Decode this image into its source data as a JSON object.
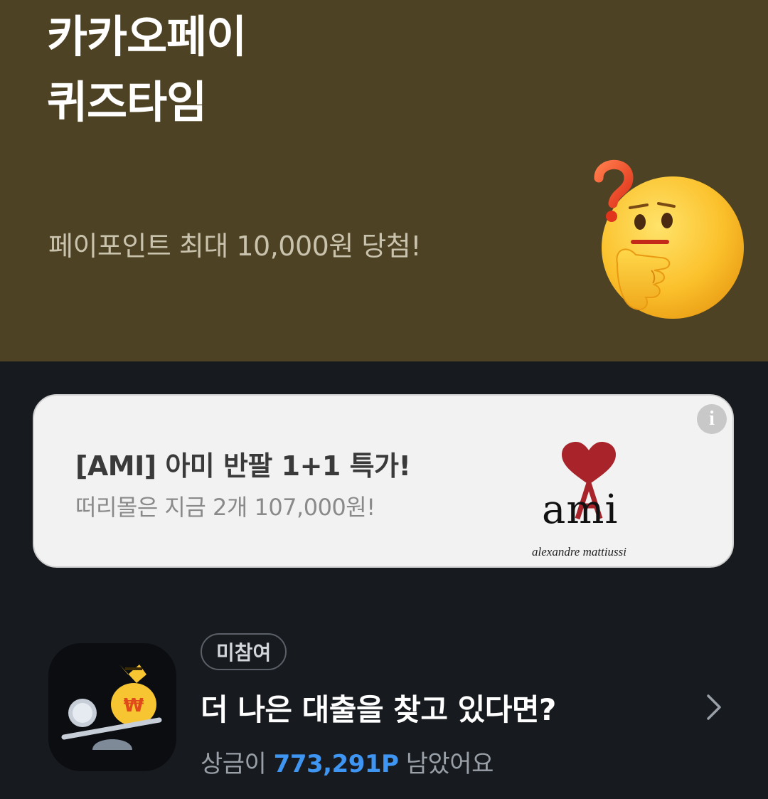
{
  "hero": {
    "title_line1": "카카오페이",
    "title_line2": "퀴즈타임",
    "subtitle": "페이포인트 최대 10,000원 당첨!",
    "bg_color": "#4e4224",
    "emoji_icon": "thinking-face-icon"
  },
  "ad": {
    "title": "[AMI] 아미 반팔 1+1 특가!",
    "description": "떠리몰은 지금 2개 107,000원!",
    "logo_word": "ami",
    "logo_sub": "alexandre mattiussi",
    "info_icon": "i",
    "brand_color": "#a8232a"
  },
  "quiz": {
    "badge": "미참여",
    "title": "더 나은 대출을 찾고 있다면?",
    "prize_prefix": "상금이",
    "prize_amount": "773,291P",
    "prize_suffix": "남았어요",
    "accent_color": "#3f95f2",
    "icon": "loan-scale-moneybag-icon"
  }
}
